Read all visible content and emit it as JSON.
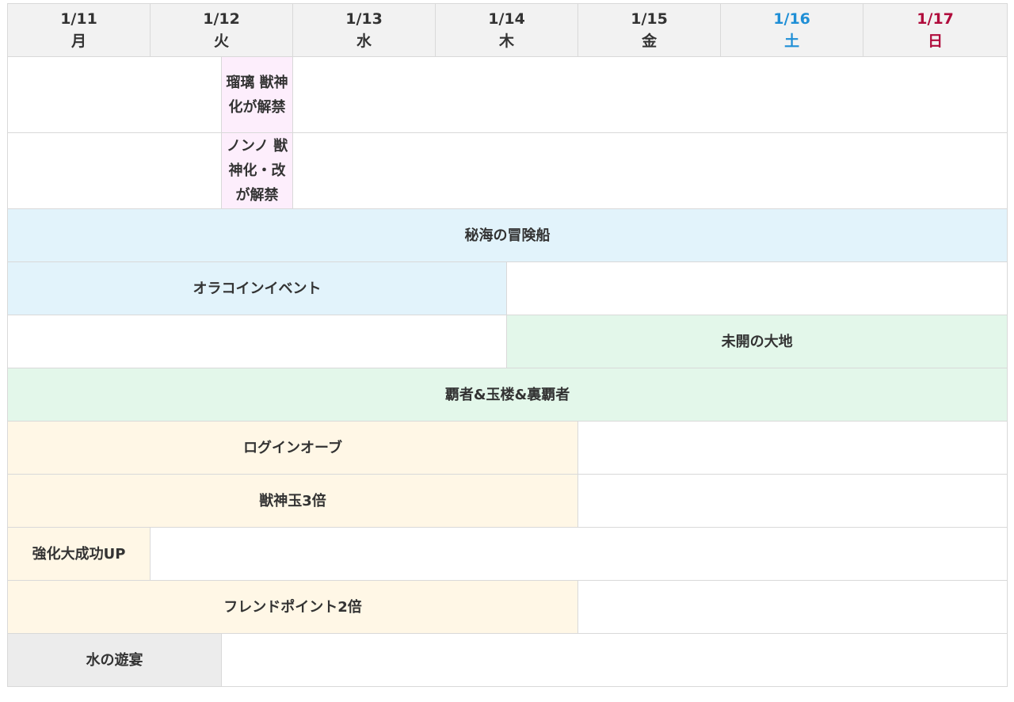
{
  "colors": {
    "sat": "#1f8fd6",
    "sun": "#b00c3c",
    "weekday": "#333333",
    "header_bg": "#f2f2f2",
    "pink": "#fdeefc",
    "blue": "#e2f3fb",
    "green": "#e3f7ea",
    "cream": "#fff7e6",
    "gray": "#ececec"
  },
  "days": [
    {
      "date": "1/11",
      "dow": "月",
      "type": "weekday"
    },
    {
      "date": "1/12",
      "dow": "火",
      "type": "weekday"
    },
    {
      "date": "1/13",
      "dow": "水",
      "type": "weekday"
    },
    {
      "date": "1/14",
      "dow": "木",
      "type": "weekday"
    },
    {
      "date": "1/15",
      "dow": "金",
      "type": "weekday"
    },
    {
      "date": "1/16",
      "dow": "土",
      "type": "sat"
    },
    {
      "date": "1/17",
      "dow": "日",
      "type": "sun"
    }
  ],
  "rows": [
    {
      "tall": true,
      "cells": [
        {
          "units": 3
        },
        {
          "text": "瑠璃 獣神化が解禁",
          "units": 1,
          "color": "pink"
        },
        {
          "units": 10
        }
      ]
    },
    {
      "tall": true,
      "cells": [
        {
          "units": 3
        },
        {
          "text": "ノンノ 獣神化・改が解禁",
          "units": 1,
          "color": "pink"
        },
        {
          "units": 10
        }
      ]
    },
    {
      "cells": [
        {
          "text": "秘海の冒険船",
          "units": 14,
          "color": "blue"
        }
      ]
    },
    {
      "cells": [
        {
          "text": "オラコインイベント",
          "units": 7,
          "color": "blue"
        },
        {
          "units": 7
        }
      ]
    },
    {
      "cells": [
        {
          "units": 7
        },
        {
          "text": "未開の大地",
          "units": 7,
          "color": "green"
        }
      ]
    },
    {
      "cells": [
        {
          "text": "覇者&玉楼&裏覇者",
          "units": 14,
          "color": "green"
        }
      ]
    },
    {
      "cells": [
        {
          "text": "ログインオーブ",
          "units": 8,
          "color": "cream"
        },
        {
          "units": 6
        }
      ]
    },
    {
      "cells": [
        {
          "text": "獣神玉3倍",
          "units": 8,
          "color": "cream"
        },
        {
          "units": 6
        }
      ]
    },
    {
      "cells": [
        {
          "text": "強化大成功UP",
          "units": 2,
          "color": "cream"
        },
        {
          "units": 12
        }
      ]
    },
    {
      "cells": [
        {
          "text": "フレンドポイント2倍",
          "units": 8,
          "color": "cream"
        },
        {
          "units": 6
        }
      ]
    },
    {
      "cells": [
        {
          "text": "水の遊宴",
          "units": 3,
          "color": "gray"
        },
        {
          "units": 11
        }
      ]
    }
  ]
}
